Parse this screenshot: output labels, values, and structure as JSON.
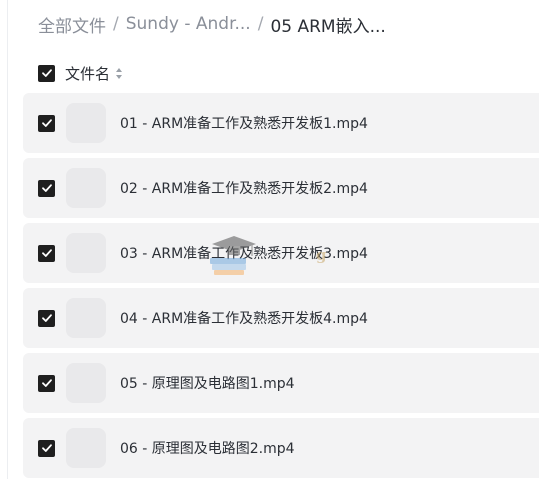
{
  "breadcrumb": {
    "root": "全部文件",
    "separator": "/",
    "folder": "Sundy - Andr...",
    "current": "05 ARM嵌入..."
  },
  "list_header": {
    "column_label": "文件名",
    "select_all_checked": true,
    "sort_icon": "sort-updown-icon"
  },
  "files": [
    {
      "name": "01 - ARM准备工作及熟悉开发板1.mp4",
      "checked": true
    },
    {
      "name": "02 - ARM准备工作及熟悉开发板2.mp4",
      "checked": true
    },
    {
      "name": "03 - ARM准备工作及熟悉开发板3.mp4",
      "checked": true
    },
    {
      "name": "04 - ARM准备工作及熟悉开发板4.mp4",
      "checked": true
    },
    {
      "name": "05 - 原理图及电路图1.mp4",
      "checked": true
    },
    {
      "name": "06 - 原理图及电路图2.mp4",
      "checked": true
    }
  ],
  "watermark": {
    "text": "g",
    "icon": "graduation-cap-books-icon"
  },
  "colors": {
    "checkbox": "#1f1f1f",
    "row_background": "#f3f3f4",
    "thumbnail_placeholder": "#e9e9eb",
    "breadcrumb_muted": "#8a8f99",
    "text": "#2b2f36"
  }
}
